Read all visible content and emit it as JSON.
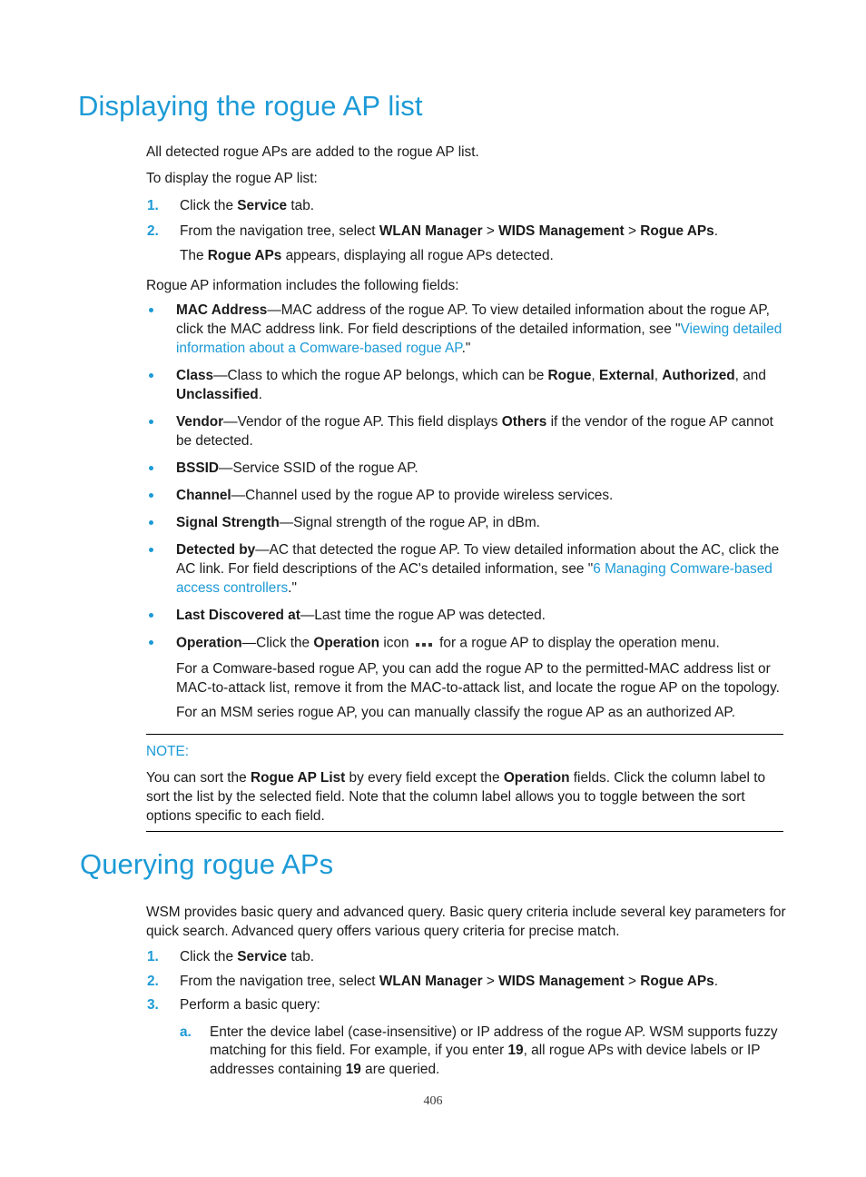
{
  "page": {
    "number": "406"
  },
  "sections": [
    {
      "heading": "Displaying the rogue AP list",
      "intro_1": "All detected rogue APs are added to the rogue AP list.",
      "intro_2": "To display the rogue AP list:",
      "steps": [
        {
          "marker": "1.",
          "text_a": "Click the ",
          "bold_a": "Service",
          "text_b": " tab."
        },
        {
          "marker": "2.",
          "text_a": "From the navigation tree, select ",
          "bold_a": "WLAN Manager",
          "sep_a": " > ",
          "bold_b": "WIDS Management",
          "sep_b": " > ",
          "bold_c": "Rogue APs",
          "text_b": "."
        }
      ],
      "step2_note_a": "The ",
      "step2_note_bold": "Rogue APs",
      "step2_note_b": " appears, displaying all rogue APs detected.",
      "fields_lead": "Rogue AP information includes the following fields:",
      "fields": [
        {
          "term": "MAC Address",
          "dash": "—",
          "desc_1": "MAC address of the rogue AP. To view detailed information about the rogue AP, click the MAC address link. For field descriptions of the detailed information, see \"",
          "link": "Viewing detailed information about a Comware-based rogue AP",
          "desc_2": ".\""
        },
        {
          "term": "Class",
          "dash": "—",
          "desc_1": "Class to which the rogue AP belongs, which can be ",
          "bold_1": "Rogue",
          "sep_1": ", ",
          "bold_2": "External",
          "sep_2": ", ",
          "bold_3": "Authorized",
          "sep_3": ", and ",
          "bold_4": "Unclassified",
          "desc_2": "."
        },
        {
          "term": "Vendor",
          "dash": "—",
          "desc_1": "Vendor of the rogue AP. This field displays ",
          "bold_1": "Others",
          "desc_2": " if the vendor of the rogue AP cannot be detected."
        },
        {
          "term": "BSSID",
          "dash": "—",
          "desc_1": "Service SSID of the rogue AP."
        },
        {
          "term": "Channel",
          "dash": "—",
          "desc_1": "Channel used by the rogue AP to provide wireless services."
        },
        {
          "term": "Signal Strength",
          "dash": "—",
          "desc_1": "Signal strength of the rogue AP, in dBm."
        },
        {
          "term": "Detected by",
          "dash": "—",
          "desc_1": "AC that detected the rogue AP. To view detailed information about the AC, click the AC link. For field descriptions of the AC's detailed information, see \"",
          "link": "6 Managing Comware-based access controllers",
          "desc_2": ".\""
        },
        {
          "term": "Last Discovered at",
          "dash": "—",
          "desc_1": "Last time the rogue AP was detected."
        },
        {
          "term": "Operation",
          "dash": "—",
          "desc_1": "Click the ",
          "bold_1": "Operation",
          "desc_2": " icon ",
          "icon": "ellipsis-icon",
          "desc_3": " for a rogue AP to display the operation menu."
        }
      ],
      "operation_para_1": "For a Comware-based rogue AP, you can add the rogue AP to the permitted-MAC address list or MAC-to-attack list, remove it from the MAC-to-attack list, and locate the rogue AP on the topology.",
      "operation_para_2": "For an MSM series rogue AP, you can manually classify the rogue AP as an authorized AP.",
      "note": {
        "label": "NOTE:",
        "text_1": "You can sort the ",
        "bold_1": "Rogue AP List",
        "text_2": " by every field except the ",
        "bold_2": "Operation",
        "text_3": " fields. Click the column label to sort the list by the selected field. Note that the column label allows you to toggle between the sort options specific to each field."
      }
    },
    {
      "heading": "Querying rogue APs",
      "intro_1": "WSM provides basic query and advanced query. Basic query criteria include several key parameters for quick search. Advanced query offers various query criteria for precise match.",
      "steps": [
        {
          "marker": "1.",
          "text_a": "Click the ",
          "bold_a": "Service",
          "text_b": " tab."
        },
        {
          "marker": "2.",
          "text_a": "From the navigation tree, select ",
          "bold_a": "WLAN Manager",
          "sep_a": " > ",
          "bold_b": "WIDS Management",
          "sep_b": " > ",
          "bold_c": "Rogue APs",
          "text_b": "."
        },
        {
          "marker": "3.",
          "text_a": "Perform a basic query:"
        }
      ],
      "substeps": [
        {
          "marker": "a.",
          "text_1": "Enter the device label (case-insensitive) or IP address of the rogue AP. WSM supports fuzzy matching for this field. For example, if you enter ",
          "bold_1": "19",
          "text_2": ", all rogue APs with device labels or IP addresses containing ",
          "bold_2": "19",
          "text_3": " are queried."
        }
      ]
    }
  ],
  "colors": {
    "heading": "#1c9ad6",
    "link": "#1c9ad6",
    "marker": "#1c9ad6",
    "body": "#1a1a1a"
  }
}
